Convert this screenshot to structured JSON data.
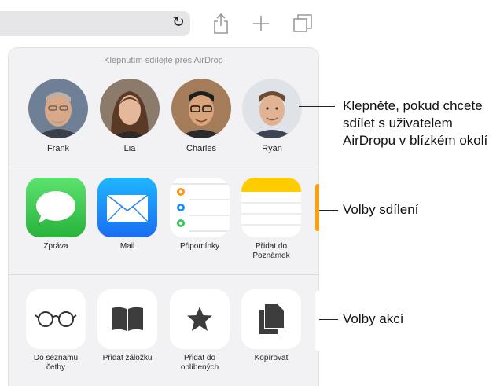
{
  "toolbar": {
    "reload_icon": "reload-icon",
    "share_icon": "share-icon",
    "add_icon": "plus-icon",
    "tabs_icon": "tabs-icon"
  },
  "airdrop": {
    "title": "Klepnutím sdílejte přes AirDrop",
    "people": [
      {
        "name": "Frank"
      },
      {
        "name": "Lia"
      },
      {
        "name": "Charles"
      },
      {
        "name": "Ryan"
      }
    ]
  },
  "share_options": [
    {
      "label": "Zpráva",
      "icon": "messages-icon",
      "color": "#34c759"
    },
    {
      "label": "Mail",
      "icon": "mail-icon",
      "color": "#1e8cf6"
    },
    {
      "label": "Připomínky",
      "icon": "reminders-icon",
      "color": "#ffffff"
    },
    {
      "label": "Přidat do Poznámek",
      "icon": "notes-icon",
      "color": "#ffd60a"
    }
  ],
  "actions": [
    {
      "label": "Do seznamu četby",
      "icon": "glasses-icon"
    },
    {
      "label": "Přidat záložku",
      "icon": "book-icon"
    },
    {
      "label": "Přidat do oblíbených",
      "icon": "star-icon"
    },
    {
      "label": "Kopírovat",
      "icon": "copy-icon"
    }
  ],
  "callouts": {
    "airdrop": "Klepněte, pokud chcete sdílet s uživatelem AirDropu v blízkém okolí",
    "share": "Volby sdílení",
    "actions": "Volby akcí"
  }
}
